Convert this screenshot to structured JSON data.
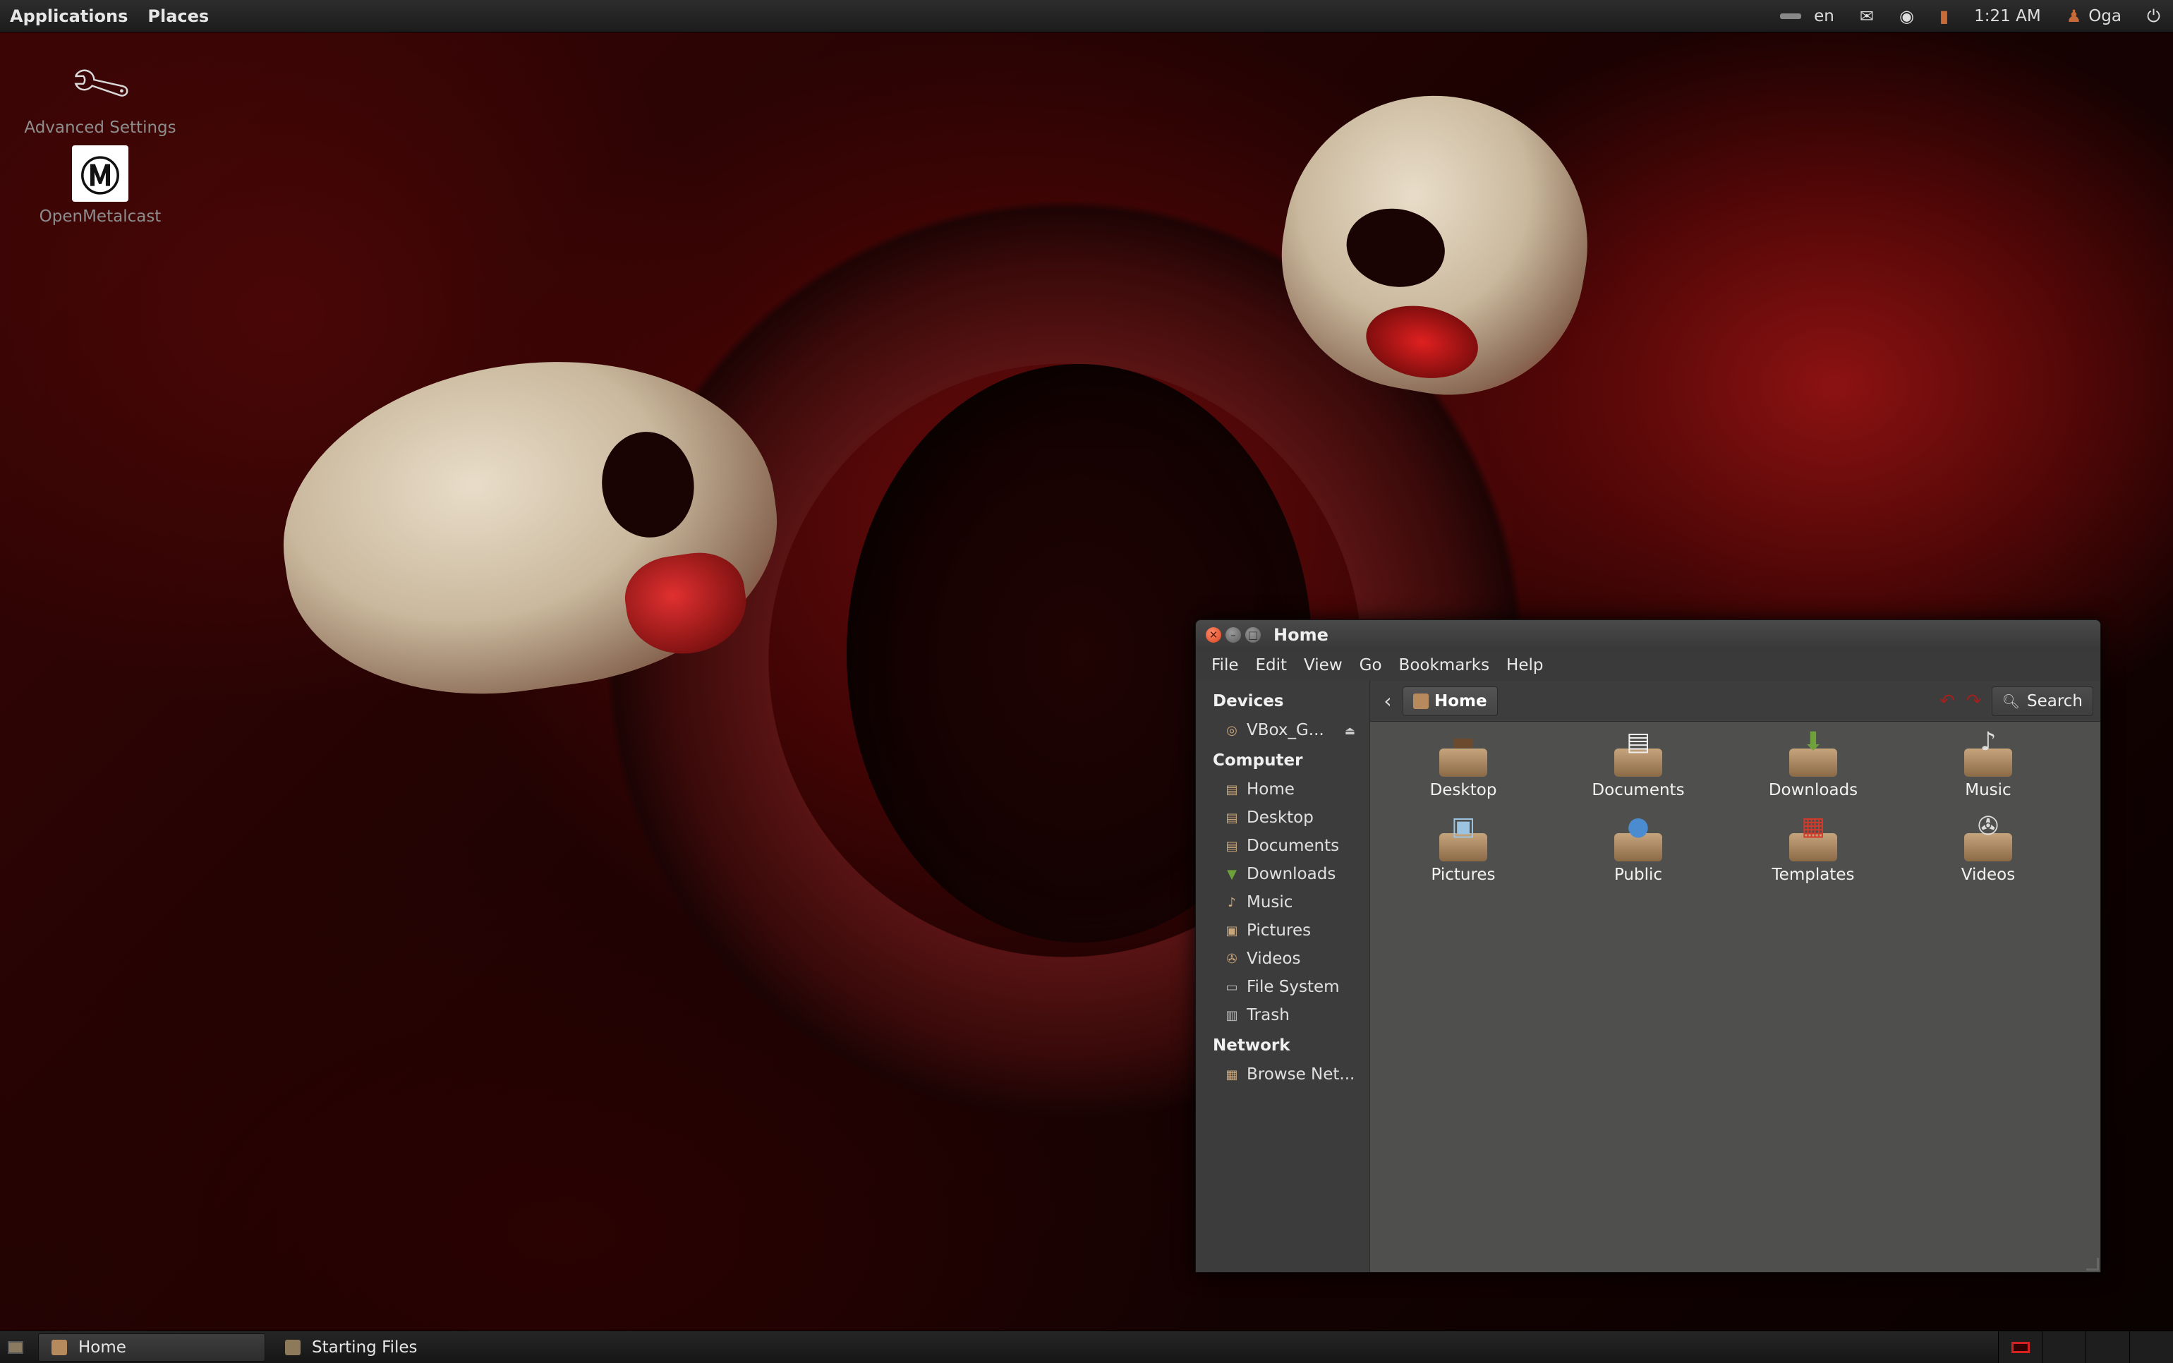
{
  "top_panel": {
    "menus": [
      "Applications",
      "Places"
    ],
    "keyboard_layout": "en",
    "clock": "1:21 AM",
    "user": "Oga"
  },
  "desktop_icons": [
    {
      "label": "Advanced Settings",
      "icon": "wrench-icon"
    },
    {
      "label": "OpenMetalcast",
      "icon": "openmetalcast-logo-icon"
    }
  ],
  "window": {
    "title": "Home",
    "menubar": [
      "File",
      "Edit",
      "View",
      "Go",
      "Bookmarks",
      "Help"
    ],
    "sidebar": {
      "devices_header": "Devices",
      "devices": [
        {
          "label": "VBox_G...",
          "icon": "cdrom-icon"
        }
      ],
      "computer_header": "Computer",
      "computer": [
        {
          "label": "Home",
          "icon": "home-folder-icon"
        },
        {
          "label": "Desktop",
          "icon": "desktop-folder-icon"
        },
        {
          "label": "Documents",
          "icon": "documents-folder-icon"
        },
        {
          "label": "Downloads",
          "icon": "downloads-folder-icon"
        },
        {
          "label": "Music",
          "icon": "music-folder-icon"
        },
        {
          "label": "Pictures",
          "icon": "pictures-folder-icon"
        },
        {
          "label": "Videos",
          "icon": "videos-folder-icon"
        },
        {
          "label": "File System",
          "icon": "filesystem-icon"
        },
        {
          "label": "Trash",
          "icon": "trash-icon"
        }
      ],
      "network_header": "Network",
      "network": [
        {
          "label": "Browse Net...",
          "icon": "network-icon"
        }
      ]
    },
    "location": "Home",
    "search_label": "Search",
    "files": [
      {
        "label": "Desktop",
        "icon": "desktop-folder-icon"
      },
      {
        "label": "Documents",
        "icon": "documents-folder-icon"
      },
      {
        "label": "Downloads",
        "icon": "downloads-folder-icon"
      },
      {
        "label": "Music",
        "icon": "music-folder-icon"
      },
      {
        "label": "Pictures",
        "icon": "pictures-folder-icon"
      },
      {
        "label": "Public",
        "icon": "public-folder-icon"
      },
      {
        "label": "Templates",
        "icon": "templates-folder-icon"
      },
      {
        "label": "Videos",
        "icon": "videos-folder-icon"
      }
    ]
  },
  "taskbar": {
    "tasks": [
      {
        "label": "Home",
        "active": true
      },
      {
        "label": "Starting Files",
        "active": false
      }
    ]
  },
  "colors": {
    "accent_red": "#d32020",
    "folder_tan": "#b68a5c",
    "window_bg": "#4f4f4e"
  }
}
